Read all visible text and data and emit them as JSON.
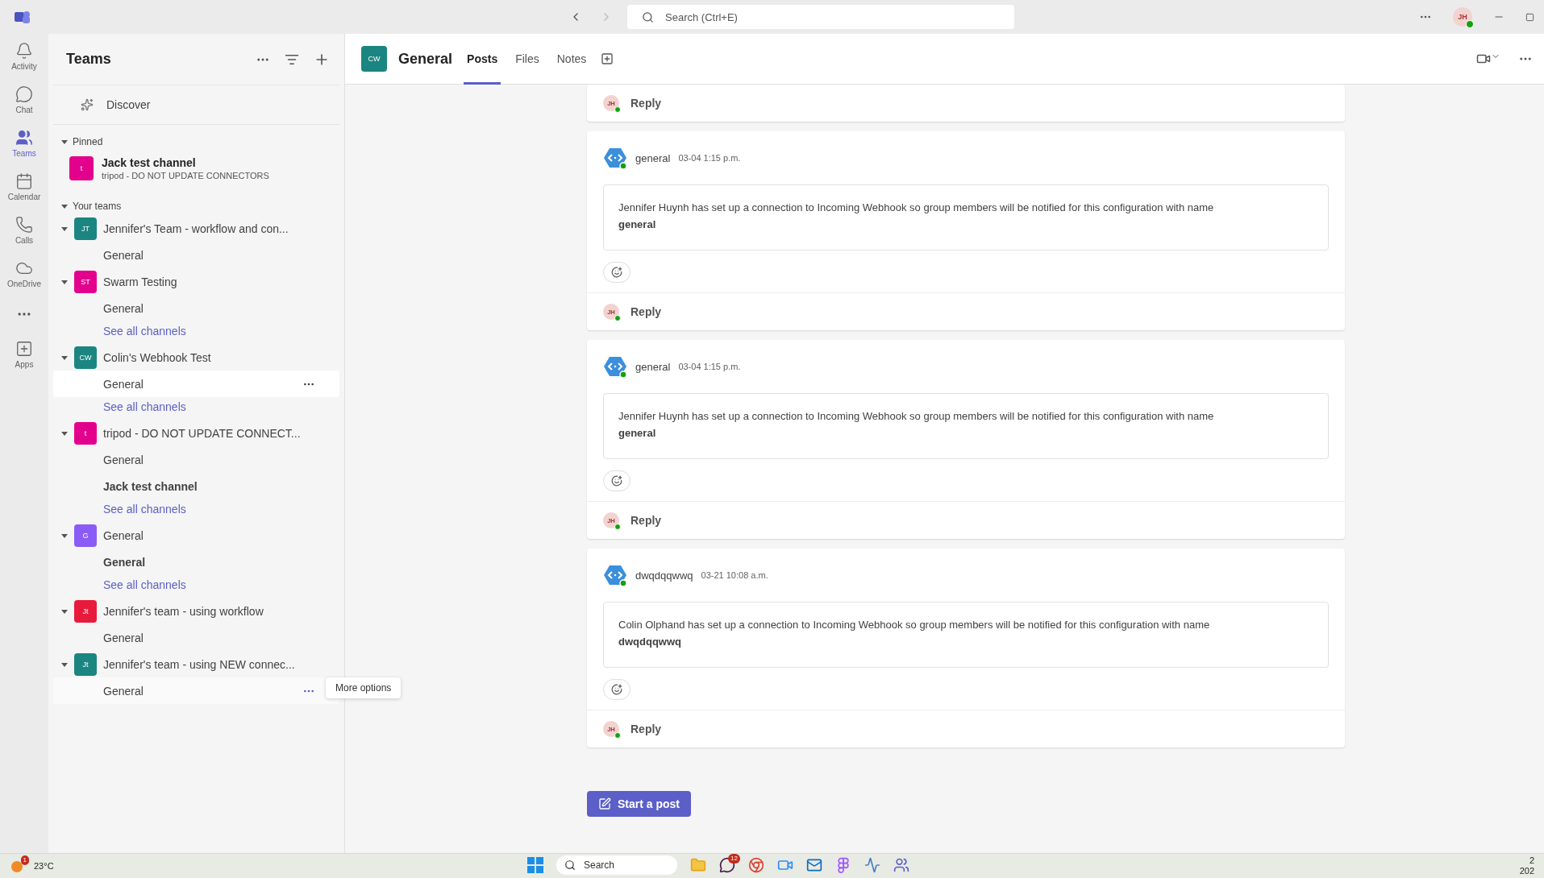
{
  "title_bar": {
    "search_placeholder": "Search (Ctrl+E)",
    "avatar": "JH"
  },
  "rail": [
    {
      "label": "Activity",
      "selected": false
    },
    {
      "label": "Chat",
      "selected": false
    },
    {
      "label": "Teams",
      "selected": true
    },
    {
      "label": "Calendar",
      "selected": false
    },
    {
      "label": "Calls",
      "selected": false
    },
    {
      "label": "OneDrive",
      "selected": false
    },
    {
      "label": "Apps",
      "selected": false
    }
  ],
  "sidebar": {
    "title": "Teams",
    "discover": "Discover",
    "pinned": {
      "label": "Pinned",
      "expanded": true,
      "items": [
        {
          "title": "Jack test channel",
          "subtitle": "tripod - DO NOT UPDATE CONNECTORS",
          "initials": "t",
          "color": "#e3008c"
        }
      ]
    },
    "your_teams": {
      "label": "Your teams",
      "expanded": true,
      "teams": [
        {
          "name": "Jennifer's Team - workflow and con...",
          "initials": "JT",
          "color": "#1b8581",
          "expanded": true,
          "channels": [
            {
              "name": "General",
              "unread": false,
              "selected": false
            }
          ]
        },
        {
          "name": "Swarm Testing",
          "initials": "ST",
          "color": "#e3008c",
          "expanded": true,
          "channels": [
            {
              "name": "General",
              "unread": false,
              "selected": false
            }
          ],
          "see_all": "See all channels"
        },
        {
          "name": "Colin's Webhook Test",
          "initials": "CW",
          "color": "#1b8581",
          "expanded": true,
          "channels": [
            {
              "name": "General",
              "unread": false,
              "selected": true
            }
          ],
          "see_all": "See all channels"
        },
        {
          "name": "tripod - DO NOT UPDATE CONNECT...",
          "initials": "t",
          "color": "#e3008c",
          "expanded": true,
          "channels": [
            {
              "name": "General",
              "unread": false,
              "selected": false
            },
            {
              "name": "Jack test channel",
              "unread": true,
              "selected": false
            }
          ],
          "see_all": "See all channels"
        },
        {
          "name": "General",
          "initials": "G",
          "color": "#8a5cf5",
          "expanded": true,
          "channels": [
            {
              "name": "General",
              "unread": true,
              "selected": false
            }
          ],
          "see_all": "See all channels"
        },
        {
          "name": "Jennifer's team - using workflow",
          "initials": "Jt",
          "color": "#e81a3b",
          "expanded": true,
          "channels": [
            {
              "name": "General",
              "unread": false,
              "selected": false
            }
          ]
        },
        {
          "name": "Jennifer's team - using NEW connec...",
          "initials": "Jt",
          "color": "#1b8581",
          "expanded": true,
          "channels": [
            {
              "name": "General",
              "unread": false,
              "selected": false,
              "tooltip": "More options"
            }
          ]
        }
      ]
    }
  },
  "channel_header": {
    "initials": "CW",
    "title": "General",
    "tabs": [
      {
        "label": "Posts",
        "selected": true
      },
      {
        "label": "Files",
        "selected": false
      },
      {
        "label": "Notes",
        "selected": false
      }
    ]
  },
  "feed": {
    "top_reply": {
      "avatar": "JH",
      "label": "Reply"
    },
    "posts": [
      {
        "sender": "general",
        "time": "03-04 1:15 p.m.",
        "body": "Jennifer Huynh has set up a connection to Incoming Webhook so group members will be notified for this configuration with name",
        "config_name": "general",
        "reply_avatar": "JH",
        "reply": "Reply"
      },
      {
        "sender": "general",
        "time": "03-04 1:15 p.m.",
        "body": "Jennifer Huynh has set up a connection to Incoming Webhook so group members will be notified for this configuration with name",
        "config_name": "general",
        "reply_avatar": "JH",
        "reply": "Reply"
      },
      {
        "sender": "dwqdqqwwq",
        "time": "03-21 10:08 a.m.",
        "body": "Colin Olphand has set up a connection to Incoming Webhook so group members will be notified for this configuration with name",
        "config_name": "dwqdqqwwq",
        "reply_avatar": "JH",
        "reply": "Reply"
      }
    ],
    "start_post": "Start a post"
  },
  "taskbar": {
    "weather_badge": "1",
    "temperature": "23°C",
    "search": "Search",
    "chat_badge": "12",
    "clock_time": "2",
    "clock_date": "202"
  }
}
